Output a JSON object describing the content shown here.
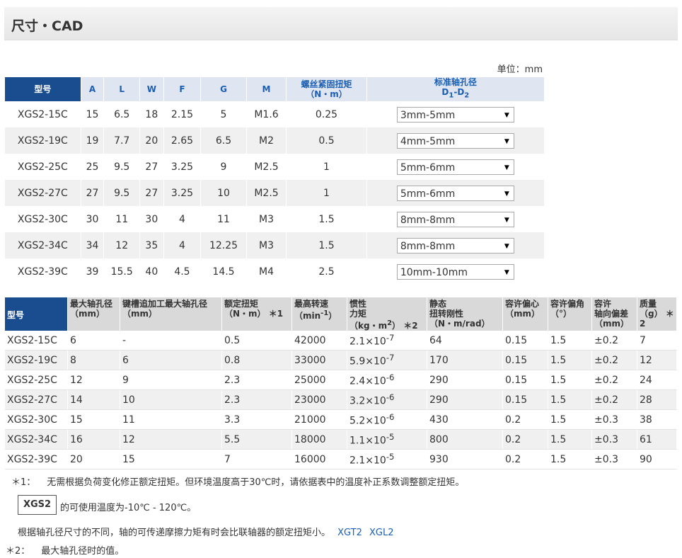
{
  "title": "尺寸・CAD",
  "unit": "单位：mm",
  "table1": {
    "headers": {
      "model": "型号",
      "A": "A",
      "L": "L",
      "W": "W",
      "F": "F",
      "G": "G",
      "M": "M",
      "torque_l1": "螺丝紧固扭矩",
      "torque_l2": "（N・m）",
      "bore_l1": "标准轴孔径",
      "bore_l2": "D1-D2"
    },
    "rows": [
      {
        "model": "XGS2-15C",
        "A": "15",
        "L": "6.5",
        "W": "18",
        "F": "2.15",
        "G": "5",
        "M": "M1.6",
        "torque": "0.25",
        "bore": "3mm-5mm"
      },
      {
        "model": "XGS2-19C",
        "A": "19",
        "L": "7.7",
        "W": "20",
        "F": "2.65",
        "G": "6.5",
        "M": "M2",
        "torque": "0.5",
        "bore": "4mm-5mm"
      },
      {
        "model": "XGS2-25C",
        "A": "25",
        "L": "9.5",
        "W": "27",
        "F": "3.25",
        "G": "9",
        "M": "M2.5",
        "torque": "1",
        "bore": "5mm-6mm"
      },
      {
        "model": "XGS2-27C",
        "A": "27",
        "L": "9.5",
        "W": "27",
        "F": "3.25",
        "G": "10",
        "M": "M2.5",
        "torque": "1",
        "bore": "5mm-6mm"
      },
      {
        "model": "XGS2-30C",
        "A": "30",
        "L": "11",
        "W": "30",
        "F": "4",
        "G": "11",
        "M": "M3",
        "torque": "1.5",
        "bore": "8mm-8mm"
      },
      {
        "model": "XGS2-34C",
        "A": "34",
        "L": "12",
        "W": "35",
        "F": "4",
        "G": "12.25",
        "M": "M3",
        "torque": "1.5",
        "bore": "8mm-8mm"
      },
      {
        "model": "XGS2-39C",
        "A": "39",
        "L": "15.5",
        "W": "40",
        "F": "4.5",
        "G": "14.5",
        "M": "M4",
        "torque": "2.5",
        "bore": "10mm-10mm"
      }
    ]
  },
  "table2": {
    "headers": {
      "model": "型号",
      "max_bore_l1": "最大轴孔径",
      "max_bore_l2": "（mm）",
      "keyway_l1": "键槽追加工最大轴孔径",
      "keyway_l2": "（mm）",
      "rated_l1": "额定扭矩",
      "rated_l2": "（N・m）",
      "rated_note": "＊1",
      "speed_l1": "最高转速",
      "speed_l2": "（min-1）",
      "inertia_l1": "惯性",
      "inertia_l2": "力矩",
      "inertia_l3": "（kg・m2）",
      "inertia_note": "＊2",
      "stiff_l1": "静态",
      "stiff_l2": "扭转刚性",
      "stiff_l3": "（N・m/rad）",
      "ecc_l1": "容许偏心",
      "ecc_l2": "（mm）",
      "ang_l1": "容许偏角",
      "ang_l2": "（°）",
      "axial_l1": "容许",
      "axial_l2": "轴向偏差",
      "axial_l3": "（mm）",
      "mass_l1": "质量",
      "mass_l2": "（g）",
      "mass_note": "＊2"
    },
    "rows": [
      {
        "model": "XGS2-15C",
        "max_bore": "6",
        "keyway": "-",
        "rated": "0.5",
        "speed": "42000",
        "inertia": "2.1×10-7",
        "stiff": "64",
        "ecc": "0.15",
        "ang": "1.5",
        "axial": "±0.2",
        "mass": "7"
      },
      {
        "model": "XGS2-19C",
        "max_bore": "8",
        "keyway": "6",
        "rated": "0.8",
        "speed": "33000",
        "inertia": "5.9×10-7",
        "stiff": "170",
        "ecc": "0.15",
        "ang": "1.5",
        "axial": "±0.2",
        "mass": "12"
      },
      {
        "model": "XGS2-25C",
        "max_bore": "12",
        "keyway": "9",
        "rated": "2.3",
        "speed": "25000",
        "inertia": "2.4×10-6",
        "stiff": "290",
        "ecc": "0.15",
        "ang": "1.5",
        "axial": "±0.2",
        "mass": "24"
      },
      {
        "model": "XGS2-27C",
        "max_bore": "14",
        "keyway": "10",
        "rated": "2.3",
        "speed": "23000",
        "inertia": "3.2×10-6",
        "stiff": "290",
        "ecc": "0.15",
        "ang": "1.5",
        "axial": "±0.2",
        "mass": "28"
      },
      {
        "model": "XGS2-30C",
        "max_bore": "15",
        "keyway": "11",
        "rated": "3.3",
        "speed": "21000",
        "inertia": "5.2×10-6",
        "stiff": "430",
        "ecc": "0.2",
        "ang": "1.5",
        "axial": "±0.3",
        "mass": "38"
      },
      {
        "model": "XGS2-34C",
        "max_bore": "16",
        "keyway": "12",
        "rated": "5.5",
        "speed": "18000",
        "inertia": "1.1×10-5",
        "stiff": "800",
        "ecc": "0.2",
        "ang": "1.5",
        "axial": "±0.3",
        "mass": "61"
      },
      {
        "model": "XGS2-39C",
        "max_bore": "20",
        "keyway": "15",
        "rated": "7",
        "speed": "16000",
        "inertia": "2.1×10-5",
        "stiff": "930",
        "ecc": "0.2",
        "ang": "1.5",
        "axial": "±0.3",
        "mass": "90"
      }
    ]
  },
  "notes": {
    "n1_tag": "＊1：",
    "n1_text": "无需根据负荷变化修正额定扭矩。但环境温度高于30℃时，请依据表中的温度补正系数调整额定扭矩。",
    "box_label": "XGS2",
    "box_text": "的可使用温度为-10℃ - 120℃。",
    "n3_text": "根据轴孔径尺寸的不同，轴的可传递摩擦力矩有时会比联轴器的额定扭矩小。",
    "link1": "XGT2",
    "link2": "XGL2",
    "n2_tag": "＊2：",
    "n2_text": "最大轴孔径时的值。"
  }
}
